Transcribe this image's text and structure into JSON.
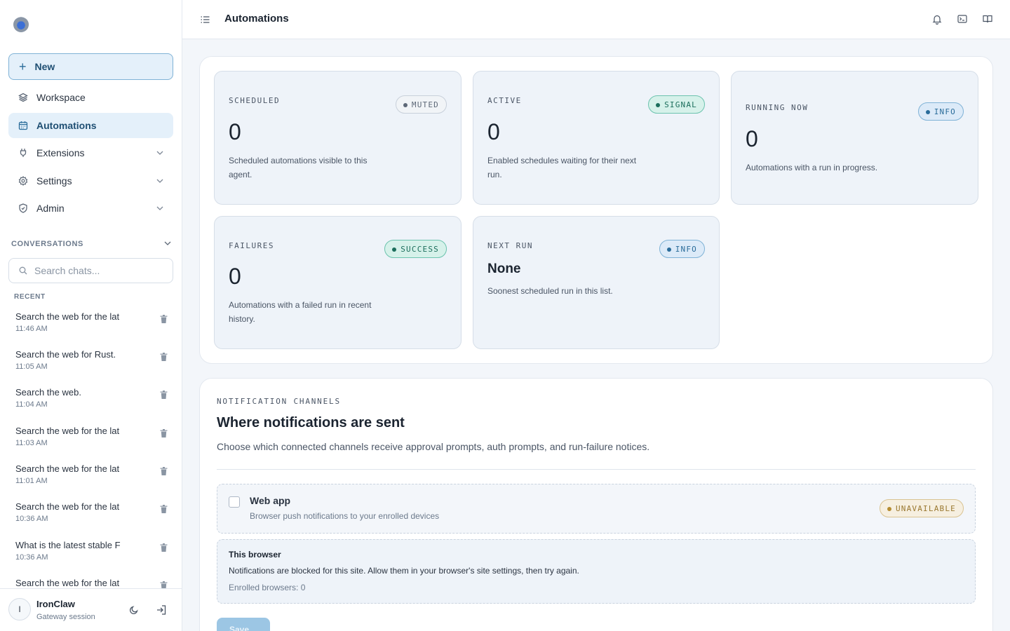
{
  "app": {
    "logo": "ironclaw-logo"
  },
  "sidebar": {
    "new_label": "New",
    "nav": [
      {
        "label": "Workspace",
        "icon": "layers-icon"
      },
      {
        "label": "Automations",
        "icon": "calendar-icon",
        "active": true
      },
      {
        "label": "Extensions",
        "icon": "plug-icon"
      },
      {
        "label": "Settings",
        "icon": "gear-icon"
      },
      {
        "label": "Admin",
        "icon": "shield-icon"
      }
    ],
    "conversations_label": "CONVERSATIONS",
    "search_placeholder": "Search chats...",
    "recent_label": "RECENT",
    "chats": [
      {
        "title": "Search the web for the lat",
        "time": "11:46 AM"
      },
      {
        "title": "Search the web for Rust.",
        "time": "11:05 AM"
      },
      {
        "title": "Search the web.",
        "time": "11:04 AM"
      },
      {
        "title": "Search the web for the lat",
        "time": "11:03 AM"
      },
      {
        "title": "Search the web for the lat",
        "time": "11:01 AM"
      },
      {
        "title": "Search the web for the lat",
        "time": "10:36 AM"
      },
      {
        "title": "What is the latest stable F",
        "time": "10:36 AM"
      },
      {
        "title": "Search the web for the lat",
        "time": ""
      }
    ],
    "user": {
      "initial": "I",
      "name": "IronClaw",
      "subtitle": "Gateway session"
    }
  },
  "header": {
    "title": "Automations"
  },
  "stats": [
    {
      "label": "SCHEDULED",
      "value": "0",
      "desc": "Scheduled automations visible to this agent.",
      "badge": "MUTED"
    },
    {
      "label": "ACTIVE",
      "value": "0",
      "desc": "Enabled schedules waiting for their next run.",
      "badge": "SIGNAL"
    },
    {
      "label": "RUNNING NOW",
      "value": "0",
      "desc": "Automations with a run in progress.",
      "badge": "INFO"
    },
    {
      "label": "FAILURES",
      "value": "0",
      "desc": "Automations with a failed run in recent history.",
      "badge": "SUCCESS"
    },
    {
      "label": "NEXT RUN",
      "value": "None",
      "desc": "Soonest scheduled run in this list.",
      "badge": "INFO"
    }
  ],
  "notifications": {
    "eyebrow": "NOTIFICATION CHANNELS",
    "title": "Where notifications are sent",
    "description": "Choose which connected channels receive approval prompts, auth prompts, and run-failure notices.",
    "channel": {
      "name": "Web app",
      "description": "Browser push notifications to your enrolled devices",
      "badge": "UNAVAILABLE",
      "checked": false
    },
    "browser": {
      "title": "This browser",
      "message": "Notifications are blocked for this site. Allow them in your browser's site settings, then try again.",
      "enrolled": "Enrolled browsers: 0"
    },
    "save_label": "Save"
  },
  "colors": {
    "accent": "#2a6c9a",
    "signal": "#1c6e5c",
    "warn": "#9a7830"
  }
}
